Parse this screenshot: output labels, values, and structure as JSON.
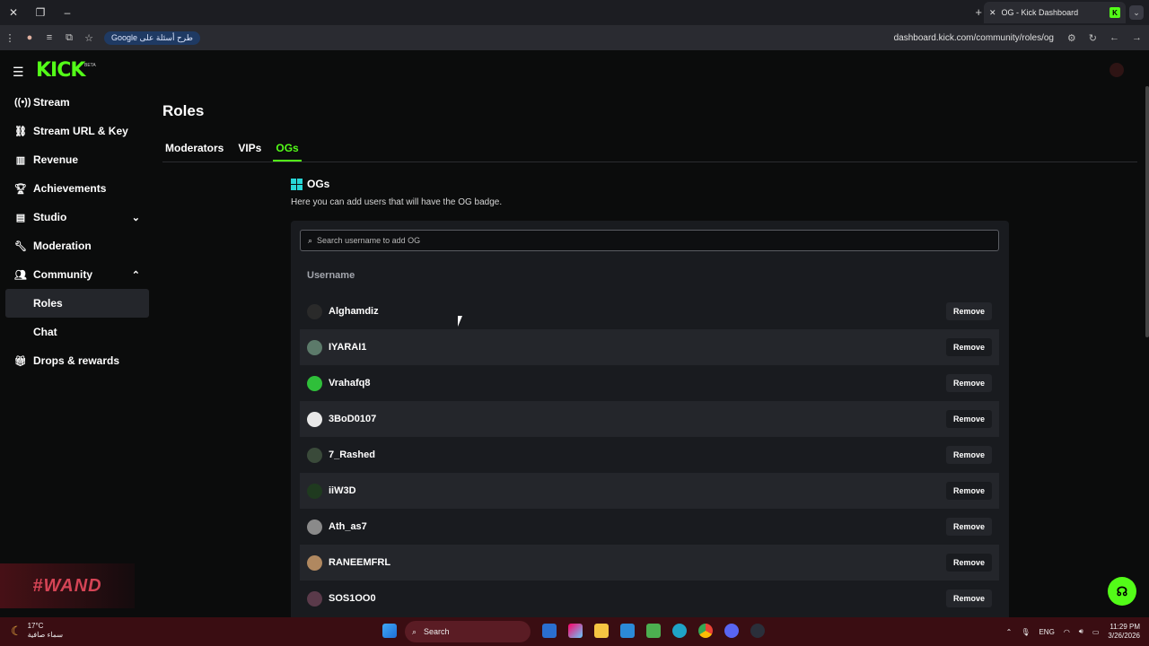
{
  "browser": {
    "tab_title": "OG - Kick Dashboard",
    "url": "dashboard.kick.com/community/roles/og",
    "search_chip": "Google طرح أسئلة على"
  },
  "brand": {
    "logo": "KICK",
    "beta": "BETA",
    "accent": "#53fc18"
  },
  "sidebar": {
    "items": [
      {
        "label": "Stream",
        "icon": "broadcast-icon"
      },
      {
        "label": "Stream URL & Key",
        "icon": "link-icon"
      },
      {
        "label": "Revenue",
        "icon": "chart-icon"
      },
      {
        "label": "Achievements",
        "icon": "trophy-icon"
      },
      {
        "label": "Studio",
        "icon": "studio-icon"
      },
      {
        "label": "Moderation",
        "icon": "wrench-icon"
      },
      {
        "label": "Community",
        "icon": "people-icon"
      },
      {
        "label": "Roles"
      },
      {
        "label": "Chat"
      },
      {
        "label": "Drops & rewards",
        "icon": "gift-icon"
      }
    ]
  },
  "main": {
    "title": "Roles",
    "tabs": [
      "Moderators",
      "VIPs",
      "OGs"
    ],
    "active_tab": "OGs",
    "section_title": "OGs",
    "section_desc": "Here you can add users that will have the OG badge.",
    "search_placeholder": "Search username to add OG",
    "column_header": "Username",
    "remove_label": "Remove",
    "users": [
      {
        "name": "Alghamdiz",
        "avatar": "#2a2a2a"
      },
      {
        "name": "IYARAI1",
        "avatar": "#5c7a6a"
      },
      {
        "name": "Vrahafq8",
        "avatar": "#2fbf3a"
      },
      {
        "name": "3BoD0107",
        "avatar": "#e8e8e8"
      },
      {
        "name": "7_Rashed",
        "avatar": "#3a4a3a"
      },
      {
        "name": "iiW3D",
        "avatar": "#1f3a1f"
      },
      {
        "name": "Ath_as7",
        "avatar": "#8a8a8a"
      },
      {
        "name": "RANEEMFRL",
        "avatar": "#b08860"
      },
      {
        "name": "SOS1OO0",
        "avatar": "#5a3a4a"
      }
    ]
  },
  "watermark": "#WAND",
  "taskbar": {
    "temperature": "17°C",
    "weather_text": "سماء صافية",
    "search_label": "Search",
    "language": "ENG",
    "time": "11:29 PM",
    "date": "3/26/2026"
  }
}
